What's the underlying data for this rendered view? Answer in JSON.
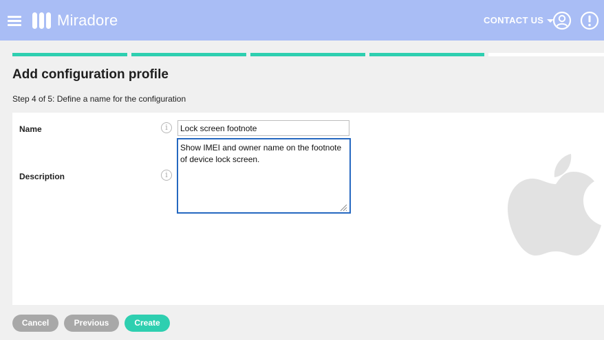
{
  "app": {
    "name": "Miradore"
  },
  "header": {
    "contact_label": "CONTACT US"
  },
  "progress": {
    "total_steps": 5,
    "completed_steps": 4,
    "active_color": "#2ecfb0",
    "inactive_color": "#ffffff"
  },
  "page": {
    "title": "Add configuration profile",
    "step_text": "Step 4 of 5: Define a name for the configuration"
  },
  "form": {
    "name_label": "Name",
    "name_value": "Lock screen footnote",
    "description_label": "Description",
    "description_value": "Show IMEI and owner name on the footnote of device lock screen.",
    "info_glyph": "i"
  },
  "platform_icon": "apple-icon",
  "buttons": {
    "cancel": "Cancel",
    "previous": "Previous",
    "create": "Create"
  },
  "colors": {
    "header": "#a9bdf5",
    "accent": "#2ecfb0",
    "secondary_button": "#a8a8a8",
    "focus": "#2467c0"
  }
}
